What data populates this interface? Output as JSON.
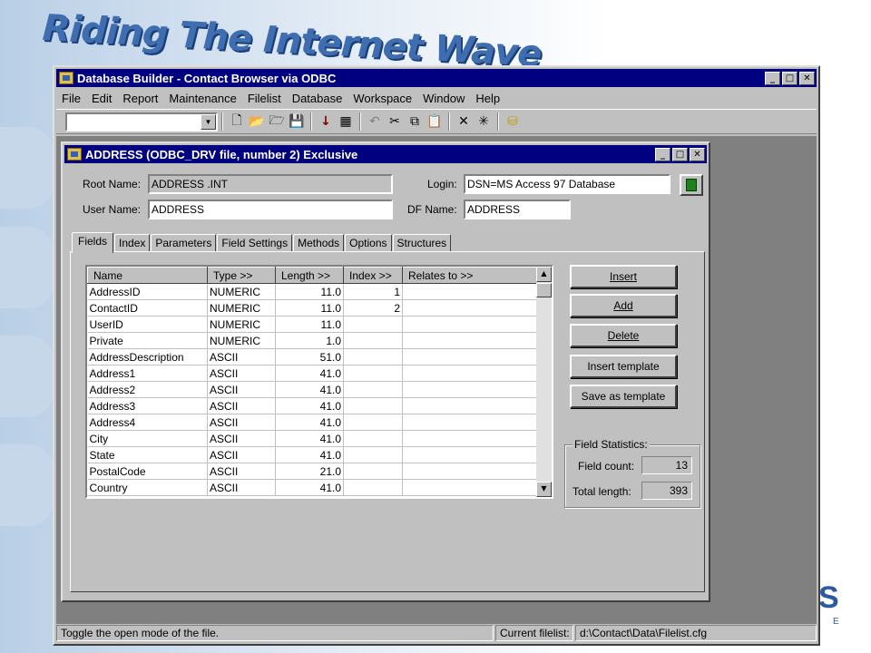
{
  "slide": {
    "title": "Riding The Internet Wave",
    "logo_text": "S",
    "logo_sub": "E"
  },
  "app": {
    "title": "Database Builder - Contact Browser via ODBC",
    "menu": [
      "File",
      "Edit",
      "Report",
      "Maintenance",
      "Filelist",
      "Database",
      "Workspace",
      "Window",
      "Help"
    ],
    "toolbar_icons": [
      "new-icon",
      "open-icon",
      "open-remote-icon",
      "save-icon",
      "sort-icon",
      "properties-icon",
      "undo-icon",
      "cut-icon",
      "copy-icon",
      "paste-icon",
      "delete-icon",
      "wand-icon",
      "database-icon"
    ]
  },
  "child": {
    "title": "ADDRESS  (ODBC_DRV file, number 2)  Exclusive",
    "root_name_label": "Root Name:",
    "root_name": "ADDRESS .INT",
    "user_name_label": "User Name:",
    "user_name": "ADDRESS",
    "login_label": "Login:",
    "login": "DSN=MS Access 97 Database",
    "df_name_label": "DF Name:",
    "df_name": "ADDRESS",
    "tabs": [
      "Fields",
      "Index",
      "Parameters",
      "Field Settings",
      "Methods",
      "Options",
      "Structures"
    ],
    "columns": [
      "Name",
      "Type >>",
      "Length >>",
      "Index >>",
      "Relates to >>"
    ],
    "rows": [
      {
        "name": "AddressID",
        "type": "NUMERIC",
        "length": "11.0",
        "index": "1",
        "relates": ""
      },
      {
        "name": "ContactID",
        "type": "NUMERIC",
        "length": "11.0",
        "index": "2",
        "relates": ""
      },
      {
        "name": "UserID",
        "type": "NUMERIC",
        "length": "11.0",
        "index": "",
        "relates": ""
      },
      {
        "name": "Private",
        "type": "NUMERIC",
        "length": "1.0",
        "index": "",
        "relates": ""
      },
      {
        "name": "AddressDescription",
        "type": "ASCII",
        "length": "51.0",
        "index": "",
        "relates": ""
      },
      {
        "name": "Address1",
        "type": "ASCII",
        "length": "41.0",
        "index": "",
        "relates": ""
      },
      {
        "name": "Address2",
        "type": "ASCII",
        "length": "41.0",
        "index": "",
        "relates": ""
      },
      {
        "name": "Address3",
        "type": "ASCII",
        "length": "41.0",
        "index": "",
        "relates": ""
      },
      {
        "name": "Address4",
        "type": "ASCII",
        "length": "41.0",
        "index": "",
        "relates": ""
      },
      {
        "name": "City",
        "type": "ASCII",
        "length": "41.0",
        "index": "",
        "relates": ""
      },
      {
        "name": "State",
        "type": "ASCII",
        "length": "41.0",
        "index": "",
        "relates": ""
      },
      {
        "name": "PostalCode",
        "type": "ASCII",
        "length": "21.0",
        "index": "",
        "relates": ""
      },
      {
        "name": "Country",
        "type": "ASCII",
        "length": "41.0",
        "index": "",
        "relates": ""
      }
    ],
    "buttons": {
      "insert": "Insert",
      "add": "Add",
      "delete": "Delete",
      "insert_template": "Insert template",
      "save_template": "Save as template"
    },
    "stats": {
      "legend": "Field Statistics:",
      "field_count_label": "Field count:",
      "field_count": "13",
      "total_length_label": "Total length:",
      "total_length": "393"
    }
  },
  "status": {
    "message": "Toggle the open mode of the file.",
    "filelist_label": "Current filelist:",
    "filelist": "d:\\Contact\\Data\\Filelist.cfg"
  }
}
